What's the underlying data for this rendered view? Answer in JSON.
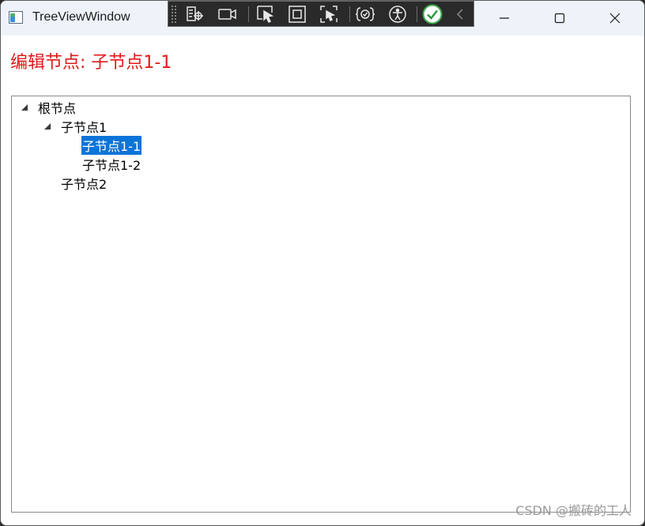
{
  "window": {
    "title": "TreeViewWindow"
  },
  "debug_toolbar": {
    "buttons": [
      "live-visual-tree-icon",
      "record-icon",
      "select-element-icon",
      "display-layout-adorners-icon",
      "track-focus-icon",
      "binding-failures-icon",
      "accessibility-icon",
      "check-icon",
      "collapse-icon"
    ]
  },
  "heading": {
    "text": "编辑节点: 子节点1-1"
  },
  "tree": {
    "nodes": [
      {
        "label": "根节点",
        "level": 0,
        "expanded": true,
        "selected": false
      },
      {
        "label": "子节点1",
        "level": 1,
        "expanded": true,
        "selected": false
      },
      {
        "label": "子节点1-1",
        "level": 2,
        "expanded": null,
        "selected": true
      },
      {
        "label": "子节点1-2",
        "level": 2,
        "expanded": null,
        "selected": false
      },
      {
        "label": "子节点2",
        "level": 1,
        "expanded": null,
        "selected": false
      }
    ]
  },
  "watermark": {
    "text": "CSDN @搬砖的工人"
  },
  "colors": {
    "heading": "#e01a1a",
    "selection": "#0a74d8",
    "titlebar": "#eef3fa"
  }
}
